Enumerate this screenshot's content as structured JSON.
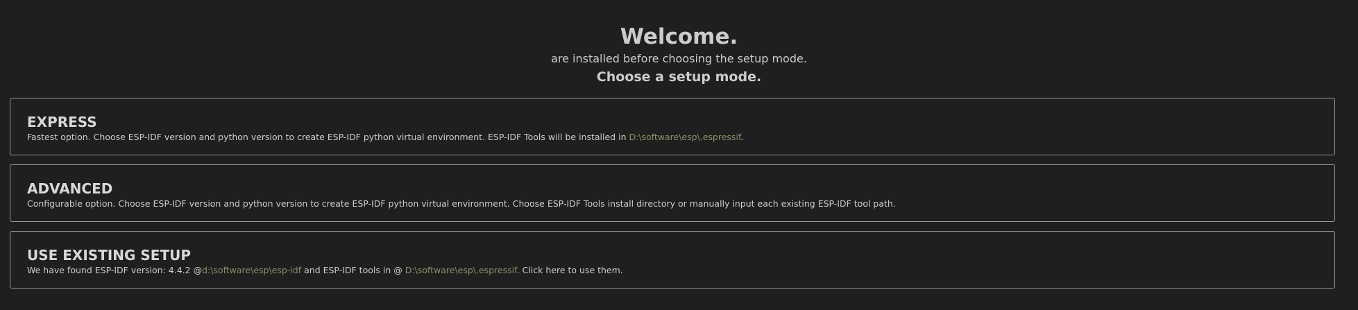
{
  "header": {
    "title": "Welcome.",
    "subtitle": "are installed before choosing the setup mode.",
    "choose": "Choose a setup mode."
  },
  "options": {
    "express": {
      "title": "EXPRESS",
      "desc_prefix": "Fastest option. Choose ESP-IDF version and python version to create ESP-IDF python virtual environment. ESP-IDF Tools will be installed in ",
      "tools_path": "D:\\software\\esp\\.espressif",
      "desc_suffix": "."
    },
    "advanced": {
      "title": "ADVANCED",
      "desc": "Configurable option. Choose ESP-IDF version and python version to create ESP-IDF python virtual environment. Choose ESP-IDF Tools install directory or manually input each existing ESP-IDF tool path."
    },
    "existing": {
      "title": "USE EXISTING SETUP",
      "desc_prefix": "We have found ESP-IDF version: 4.4.2 @",
      "idf_path": "d:\\software\\esp\\esp-idf",
      "desc_middle": " and ESP-IDF tools in @ ",
      "tools_path": "D:\\software\\esp\\.espressif",
      "desc_suffix": ". Click here to use them."
    }
  },
  "colors": {
    "background": "#1f1f1f",
    "text": "#cccccc",
    "border": "#9a9a9a",
    "path": "#8a8f6a"
  }
}
